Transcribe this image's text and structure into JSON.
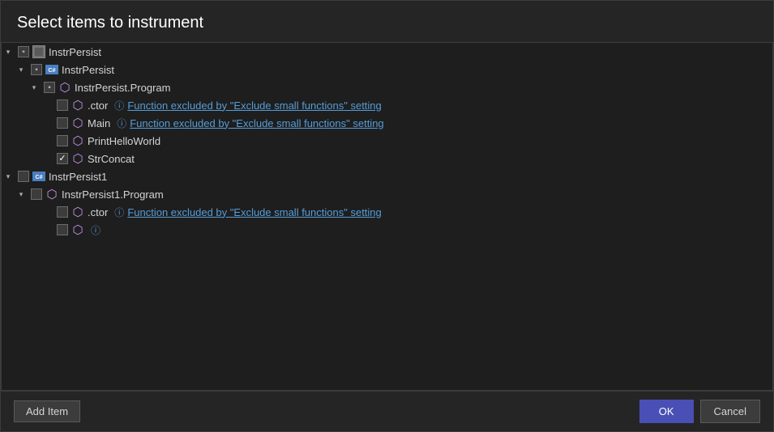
{
  "dialog": {
    "title": "Select items to instrument",
    "add_item_label": "Add Item",
    "ok_label": "OK",
    "cancel_label": "Cancel"
  },
  "tree": {
    "nodes": [
      {
        "id": "instrpersist-root",
        "level": 0,
        "expanded": true,
        "checkbox_state": "indeterminate",
        "icon_type": "assembly",
        "icon_text": "",
        "label": "InstrPersist",
        "info": false,
        "excluded_text": ""
      },
      {
        "id": "instrpersist-assembly",
        "level": 1,
        "expanded": true,
        "checkbox_state": "indeterminate",
        "icon_type": "class",
        "icon_text": "C#",
        "label": "InstrPersist",
        "info": false,
        "excluded_text": ""
      },
      {
        "id": "instrpersist-program",
        "level": 2,
        "expanded": true,
        "checkbox_state": "indeterminate",
        "icon_type": "namespace",
        "icon_text": "⬡",
        "label": "InstrPersist.Program",
        "info": false,
        "excluded_text": ""
      },
      {
        "id": "ctor1",
        "level": 3,
        "expanded": false,
        "checkbox_state": "unchecked",
        "icon_type": "method",
        "icon_text": "⬡",
        "label": ".ctor",
        "info": true,
        "excluded_text": "Function excluded by \"Exclude small functions\" setting"
      },
      {
        "id": "main",
        "level": 3,
        "expanded": false,
        "checkbox_state": "unchecked",
        "icon_type": "method",
        "icon_text": "⬡",
        "label": "Main",
        "info": true,
        "excluded_text": "Function excluded by \"Exclude small functions\" setting"
      },
      {
        "id": "printhelloworld",
        "level": 3,
        "expanded": false,
        "checkbox_state": "unchecked",
        "icon_type": "method",
        "icon_text": "⬡",
        "label": "PrintHelloWorld",
        "info": false,
        "excluded_text": ""
      },
      {
        "id": "strconcat",
        "level": 3,
        "expanded": false,
        "checkbox_state": "checked",
        "icon_type": "method",
        "icon_text": "⬡",
        "label": "StrConcat",
        "info": false,
        "excluded_text": ""
      },
      {
        "id": "instrpersist1-root",
        "level": 0,
        "expanded": true,
        "checkbox_state": "unchecked",
        "icon_type": "class",
        "icon_text": "C#",
        "label": "InstrPersist1",
        "info": false,
        "excluded_text": ""
      },
      {
        "id": "instrpersist1-program",
        "level": 1,
        "expanded": true,
        "checkbox_state": "unchecked",
        "icon_type": "namespace",
        "icon_text": "⬡",
        "label": "InstrPersist1.Program",
        "info": false,
        "excluded_text": ""
      },
      {
        "id": "ctor2",
        "level": 2,
        "expanded": false,
        "checkbox_state": "unchecked",
        "icon_type": "method",
        "icon_text": "⬡",
        "label": ".ctor",
        "info": true,
        "excluded_text": "Function excluded by \"Exclude small functions\" setting"
      },
      {
        "id": "instrpersist1-partial",
        "level": 2,
        "expanded": false,
        "checkbox_state": "unchecked",
        "icon_type": "method",
        "icon_text": "⬡",
        "label": "",
        "info": true,
        "excluded_text": ""
      }
    ]
  },
  "icons": {
    "expand": "▸",
    "collapse": "▾",
    "info": "ⓘ",
    "check": "✓"
  }
}
